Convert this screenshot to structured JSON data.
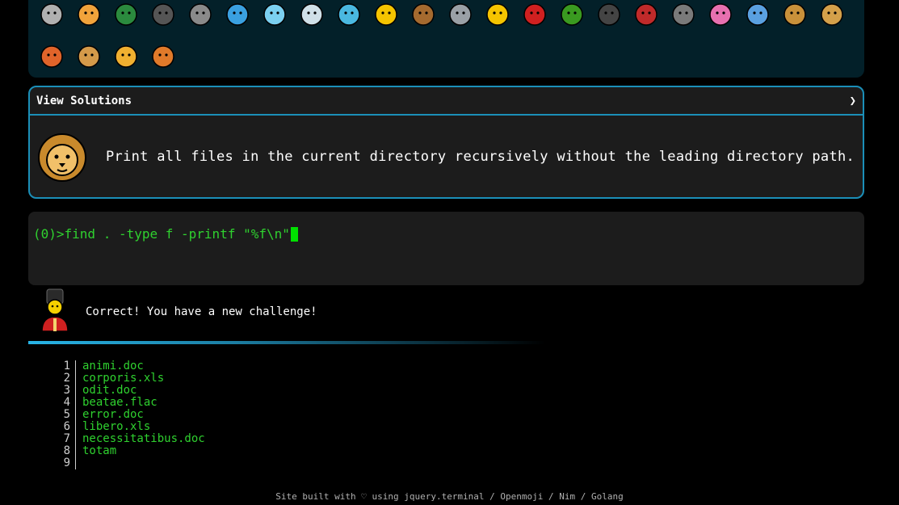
{
  "colors": {
    "accent": "#1b8fb8",
    "terminal_green": "#2fd12f",
    "panel_bg": "#032029"
  },
  "animals_row1": [
    "snail-icon",
    "butterfly-icon",
    "caterpillar-icon",
    "ant-icon",
    "spider-web-icon",
    "whale-icon",
    "dolphin-icon",
    "shark-icon",
    "fish-icon",
    "tropical-fish-icon",
    "turtle-icon",
    "wolf-icon",
    "bee-icon",
    "ladybug-icon",
    "cricket-icon",
    "spider-icon",
    "scorpion-icon",
    "fly-icon",
    "worm-icon",
    "microbe-icon",
    "monkey-icon",
    "dog-icon"
  ],
  "animals_row2": [
    "fox-icon",
    "cat-icon",
    "lion-icon",
    "tiger-icon"
  ],
  "solutions": {
    "title": "View Solutions",
    "chevron": "❯",
    "avatar": "lion-icon",
    "challenge": "Print all files in the current directory recursively without the leading directory path."
  },
  "terminal": {
    "prompt": "(0)>",
    "command": "find . -type f -printf \"%f\\n\""
  },
  "result": {
    "avatar": "guard-icon",
    "message": "Correct! You have a new challenge!"
  },
  "listing": [
    {
      "num": "1",
      "text": "animi.doc"
    },
    {
      "num": "2",
      "text": "corporis.xls"
    },
    {
      "num": "3",
      "text": "odit.doc"
    },
    {
      "num": "4",
      "text": "beatae.flac"
    },
    {
      "num": "5",
      "text": "error.doc"
    },
    {
      "num": "6",
      "text": "libero.xls"
    },
    {
      "num": "7",
      "text": "necessitatibus.doc"
    },
    {
      "num": "8",
      "text": "totam"
    },
    {
      "num": "9",
      "text": ""
    }
  ],
  "footer": "Site built with ♡ using jquery.terminal / Openmoji / Nim / Golang"
}
